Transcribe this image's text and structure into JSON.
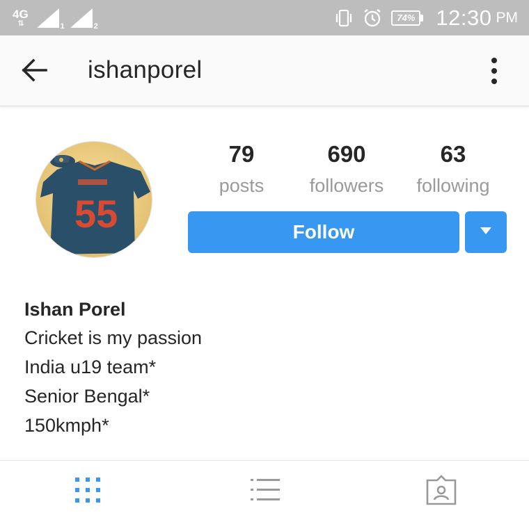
{
  "status_bar": {
    "network_type": "4G",
    "network_arrows": "⇅",
    "sim1": "1",
    "sim2": "2",
    "battery_percent": "74%",
    "time": "12:30",
    "ampm": "PM",
    "icons": [
      "signal-icon",
      "vibrate-icon",
      "alarm-icon",
      "battery-icon"
    ]
  },
  "app_bar": {
    "title": "ishanporel",
    "back_icon": "arrow-left-icon",
    "more_icon": "more-vertical-icon"
  },
  "profile": {
    "avatar_icon": "avatar",
    "stats": [
      {
        "value": "79",
        "label": "posts"
      },
      {
        "value": "690",
        "label": "followers"
      },
      {
        "value": "63",
        "label": "following"
      }
    ],
    "follow_label": "Follow",
    "accent_color": "#3897f0"
  },
  "bio": {
    "name": "Ishan Porel",
    "lines": [
      "Cricket is my passion",
      "India u19 team*",
      "Senior Bengal*",
      "150kmph*"
    ]
  },
  "tabs": [
    {
      "icon": "grid-icon",
      "active": true
    },
    {
      "icon": "list-icon",
      "active": false
    },
    {
      "icon": "tagged-photos-icon",
      "active": false
    }
  ]
}
